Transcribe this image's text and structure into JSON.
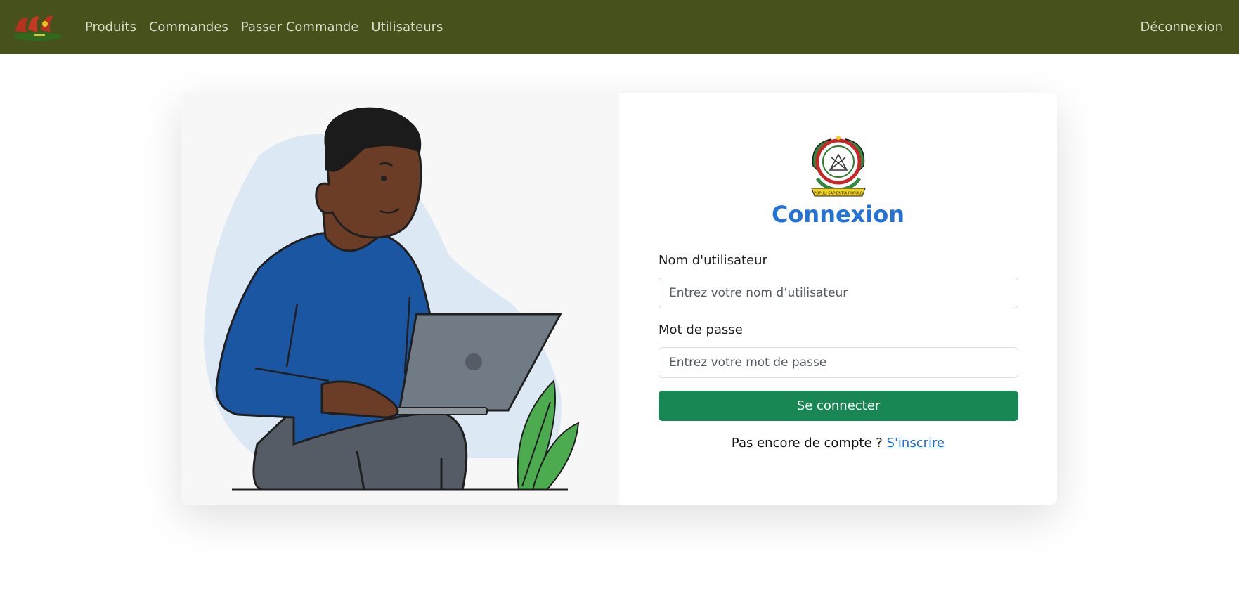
{
  "navbar": {
    "logo": "brand-logo",
    "links": [
      "Produits",
      "Commandes",
      "Passer Commande",
      "Utilisateurs"
    ],
    "logout_label": "Déconnexion",
    "background": "#46511b"
  },
  "login": {
    "emblem": "national-emblem",
    "emblem_motto": "POPULI SAPIENTIA POPULO",
    "title": "Connexion",
    "username_label": "Nom d'utilisateur",
    "username_placeholder": "Entrez votre nom d’utilisateur",
    "password_label": "Mot de passe",
    "password_placeholder": "Entrez votre mot de passe",
    "submit_label": "Se connecter",
    "signup_prompt": "Pas encore de compte ?",
    "signup_link": "S'inscrire",
    "title_color": "#2272d7",
    "button_color": "#198754"
  },
  "illustration": "person-with-laptop"
}
